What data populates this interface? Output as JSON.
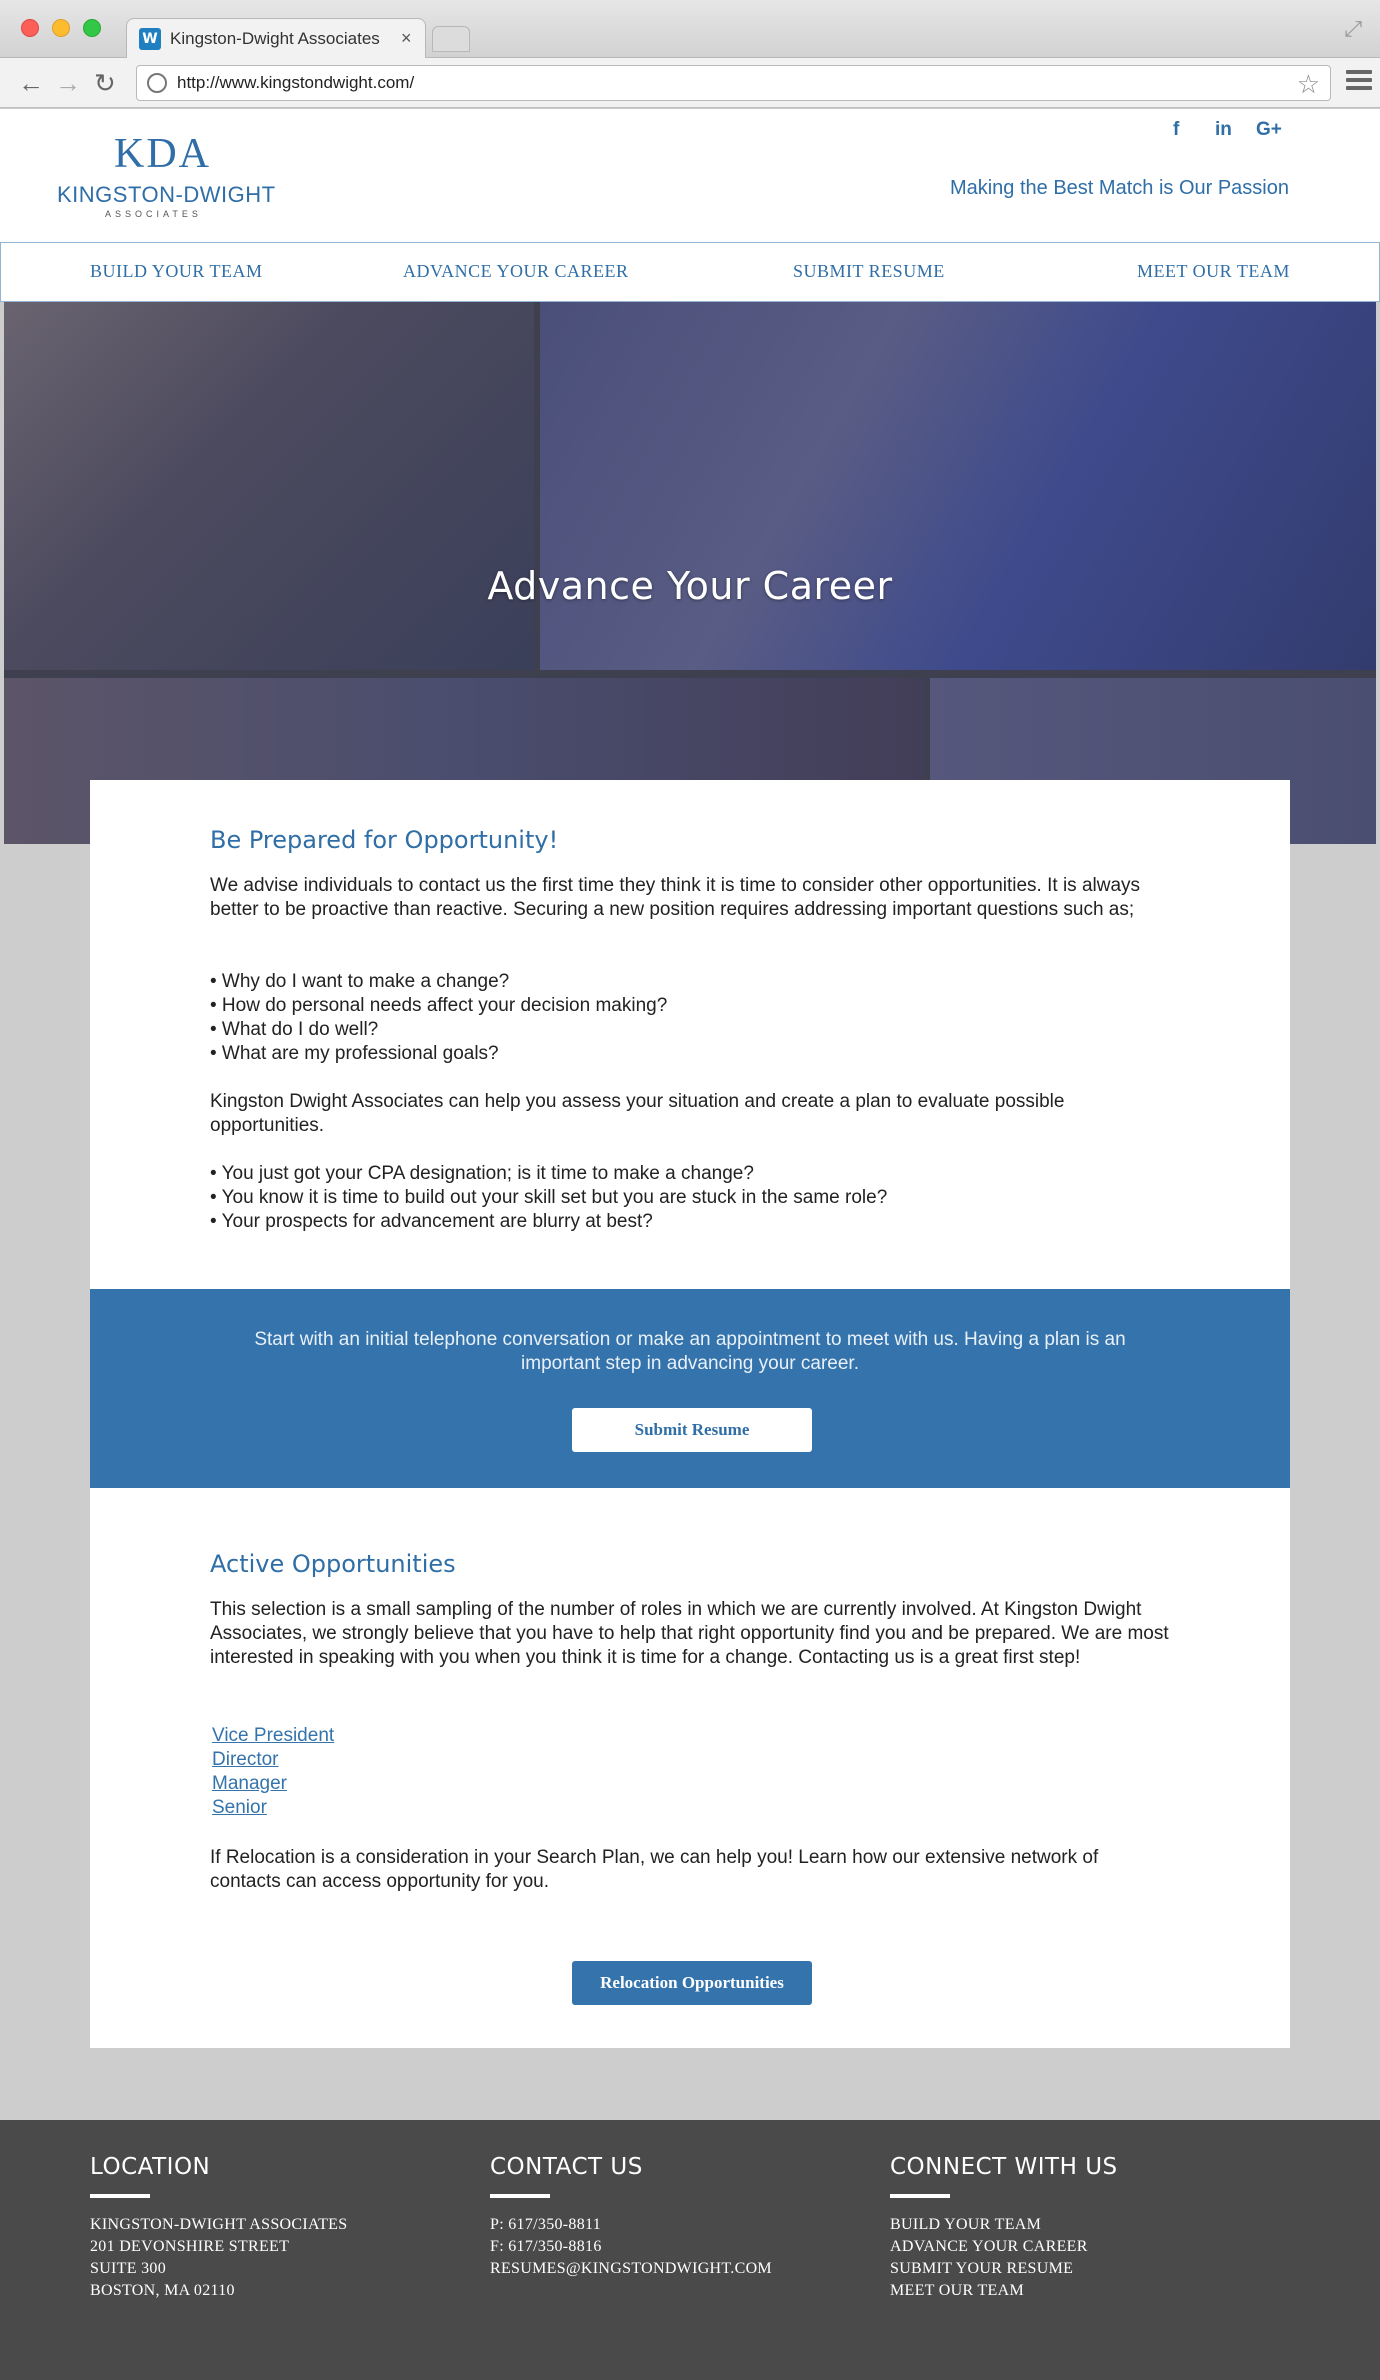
{
  "browser": {
    "tab_title": "Kingston-Dwight Associates",
    "tab_favicon_letter": "W",
    "tab_close": "×",
    "url": "http://www.kingstondwight.com/"
  },
  "header": {
    "logo_mark": "KDA",
    "logo_name": "KINGSTON-DWIGHT",
    "logo_sub": "ASSOCIATES",
    "social": {
      "facebook": "f",
      "linkedin": "in",
      "googleplus": "G+"
    },
    "tagline": "Making the Best Match is Our Passion"
  },
  "nav": [
    {
      "label": "BUILD YOUR TEAM"
    },
    {
      "label": "ADVANCE YOUR CAREER"
    },
    {
      "label": "SUBMIT RESUME"
    },
    {
      "label": "MEET OUR TEAM"
    }
  ],
  "hero": {
    "title": "Advance Your Career"
  },
  "prepared": {
    "title": "Be Prepared for Opportunity!",
    "intro": "We advise individuals to contact us the first time they think it is time to consider other opportunities. It is always better to be proactive than reactive. Securing a new position requires addressing important questions such as;",
    "questions": [
      "• Why do I want to make a change?",
      "• How do personal needs affect your decision making?",
      "• What do I do well?",
      "• What are my professional goals?"
    ],
    "help": "Kingston Dwight Associates can help you assess your situation and create a plan to evaluate possible opportunities.",
    "scenarios": [
      "• You just got your CPA designation; is it time to make a change?",
      "• You know it is time to build out your skill set but you are stuck in the same role?",
      "• Your prospects for advancement are blurry at best?"
    ]
  },
  "cta": {
    "text": "Start with an initial telephone conversation or make an appointment to meet with us. Having a plan is an important step in advancing your career.",
    "button": "Submit Resume"
  },
  "opportunities": {
    "title": "Active Opportunities",
    "intro": "This selection is a small sampling of the number of roles in which we are currently involved. At Kingston Dwight Associates, we strongly believe that you have to help that right opportunity find you and be prepared. We are most interested in speaking with you when you think it is time for a change. Contacting us is a great first step!",
    "links": [
      "Vice President",
      "Director",
      "Manager",
      "Senior"
    ],
    "relocation_text": "If Relocation is a consideration in your Search Plan, we can help you! Learn how our extensive network of contacts can access opportunity for you.",
    "relocation_button": "Relocation Opportunities"
  },
  "footer": {
    "location": {
      "title": "LOCATION",
      "lines": [
        "KINGSTON-DWIGHT ASSOCIATES",
        "201 DEVONSHIRE STREET",
        "SUITE 300",
        "BOSTON, MA 02110"
      ]
    },
    "contact": {
      "title": "CONTACT US",
      "lines": [
        "P: 617/350-8811",
        "F: 617/350-8816",
        "RESUMES@KINGSTONDWIGHT.COM"
      ]
    },
    "connect": {
      "title": "CONNECT WITH US",
      "lines": [
        "BUILD YOUR TEAM",
        "ADVANCE YOUR CAREER",
        "SUBMIT YOUR RESUME",
        "MEET OUR TEAM"
      ]
    }
  },
  "colors": {
    "brand_blue": "#3473ab",
    "footer_bg": "#4a4a4a",
    "page_bg": "#cdcdcd"
  }
}
